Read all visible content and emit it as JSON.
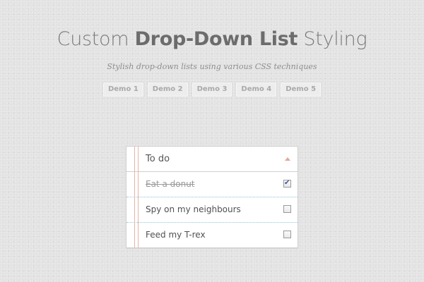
{
  "header": {
    "title_prefix": "Custom ",
    "title_strong": "Drop-Down List",
    "title_suffix": " Styling",
    "subtitle": "Stylish drop-down lists using various CSS techniques"
  },
  "demos": [
    "Demo 1",
    "Demo 2",
    "Demo 3",
    "Demo 4",
    "Demo 5"
  ],
  "dropdown": {
    "label": "To do",
    "items": [
      {
        "label": "Eat a donut",
        "checked": true
      },
      {
        "label": "Spy on my neighbours",
        "checked": false
      },
      {
        "label": "Feed my T-rex",
        "checked": false
      }
    ]
  },
  "colors": {
    "background": "#e3e3e3",
    "margin_line": "#e6b3a8",
    "rule_line": "#8ec7d2",
    "arrow": "#e6a796"
  }
}
